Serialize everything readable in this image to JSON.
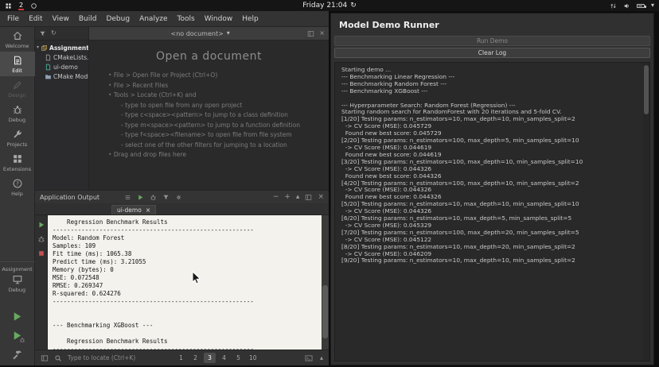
{
  "topbar": {
    "workspace_number": "2",
    "clock": "Friday 21:04"
  },
  "icons": {
    "refresh": "↻",
    "dropdown": "▾",
    "chevron_up": "▴",
    "tree_chevron": "▾",
    "close": "×",
    "plus": "+",
    "minus": "−"
  },
  "menubar": {
    "items": [
      {
        "label": "File"
      },
      {
        "label": "Edit"
      },
      {
        "label": "View"
      },
      {
        "label": "Build"
      },
      {
        "label": "Debug"
      },
      {
        "label": "Analyze"
      },
      {
        "label": "Tools"
      },
      {
        "label": "Window"
      },
      {
        "label": "Help"
      }
    ]
  },
  "modebar": {
    "items": [
      {
        "label": "Welcome"
      },
      {
        "label": "Edit"
      },
      {
        "label": "Design"
      },
      {
        "label": "Debug"
      },
      {
        "label": "Projects"
      },
      {
        "label": "Extensions"
      },
      {
        "label": "Help"
      }
    ],
    "kit_project": "Assignment",
    "kit_config": "Debug"
  },
  "project_tree": {
    "items": [
      {
        "label": "Assignment"
      },
      {
        "label": "CMakeLists.txt"
      },
      {
        "label": "ui-demo"
      },
      {
        "label": "CMake Modules"
      }
    ]
  },
  "editor": {
    "doc_tab_label": "<no document>",
    "welcome_title": "Open a document",
    "items": [
      {
        "text": "File > Open File or Project (Ctrl+O)"
      },
      {
        "text": "File > Recent Files"
      },
      {
        "text": "Tools > Locate (Ctrl+K) and"
      },
      {
        "text": "type to open file from any open project"
      },
      {
        "text": "type c<space><pattern> to jump to a class definition"
      },
      {
        "text": "type m<space><pattern> to jump to a function definition"
      },
      {
        "text": "type f<space><filename> to open file from file system"
      },
      {
        "text": "select one of the other filters for jumping to a location"
      },
      {
        "text": "Drag and drop files here"
      }
    ]
  },
  "output_pane": {
    "title": "Application Output",
    "tab_label": "ui-demo",
    "log_lines": [
      "    Regression Benchmark Results",
      "--------------------------------------------------------",
      "Model: Random Forest",
      "Samples: 109",
      "Fit time (ms): 1065.38",
      "Predict time (ms): 3.21055",
      "Memory (bytes): 0",
      "MSE: 0.072548",
      "RMSE: 0.269347",
      "R-squared: 0.624276",
      "--------------------------------------------------------",
      "",
      "",
      "--- Benchmarking XGBoost ---",
      "",
      "    Regression Benchmark Results",
      "--------------------------------------------------------"
    ]
  },
  "statusbar": {
    "locator_placeholder": "Type to locate (Ctrl+K)",
    "pane_buttons": [
      {
        "label": "1"
      },
      {
        "label": "2"
      },
      {
        "label": "3"
      },
      {
        "label": "4"
      },
      {
        "label": "5"
      },
      {
        "label": "10"
      }
    ],
    "active_pane": "3"
  },
  "runner": {
    "title": "Model Demo Runner",
    "run_button_label": "Run Demo",
    "run_button_enabled": false,
    "clear_button_label": "Clear Log",
    "log_lines": [
      "Starting demo ...",
      "--- Benchmarking Linear Regression ---",
      "--- Benchmarking Random Forest ---",
      "--- Benchmarking XGBoost ---",
      "",
      "--- Hyperparameter Search: Random Forest (Regression) ---",
      "Starting random search for RandomForest with 20 iterations and 5-fold CV.",
      "[1/20] Testing params: n_estimators=10, max_depth=10, min_samples_split=2",
      "  -> CV Score (MSE): 0.045729",
      "  Found new best score: 0.045729",
      "[2/20] Testing params: n_estimators=100, max_depth=5, min_samples_split=10",
      "  -> CV Score (MSE): 0.044619",
      "  Found new best score: 0.044619",
      "[3/20] Testing params: n_estimators=100, max_depth=10, min_samples_split=10",
      "  -> CV Score (MSE): 0.044326",
      "  Found new best score: 0.044326",
      "[4/20] Testing params: n_estimators=100, max_depth=10, min_samples_split=2",
      "  -> CV Score (MSE): 0.044326",
      "  Found new best score: 0.044326",
      "[5/20] Testing params: n_estimators=10, max_depth=10, min_samples_split=10",
      "  -> CV Score (MSE): 0.044326",
      "[6/20] Testing params: n_estimators=10, max_depth=5, min_samples_split=5",
      "  -> CV Score (MSE): 0.045329",
      "[7/20] Testing params: n_estimators=100, max_depth=20, min_samples_split=5",
      "  -> CV Score (MSE): 0.045122",
      "[8/20] Testing params: n_estimators=10, max_depth=20, min_samples_split=2",
      "  -> CV Score (MSE): 0.046209",
      "[9/20] Testing params: n_estimators=10, max_depth=10, min_samples_split=2"
    ]
  },
  "colors": {
    "run_green": "#67a95f",
    "stop_red": "#c75050",
    "workspace_badge_red": "#cf3b3b",
    "output_bg": "#f3f2ec"
  }
}
